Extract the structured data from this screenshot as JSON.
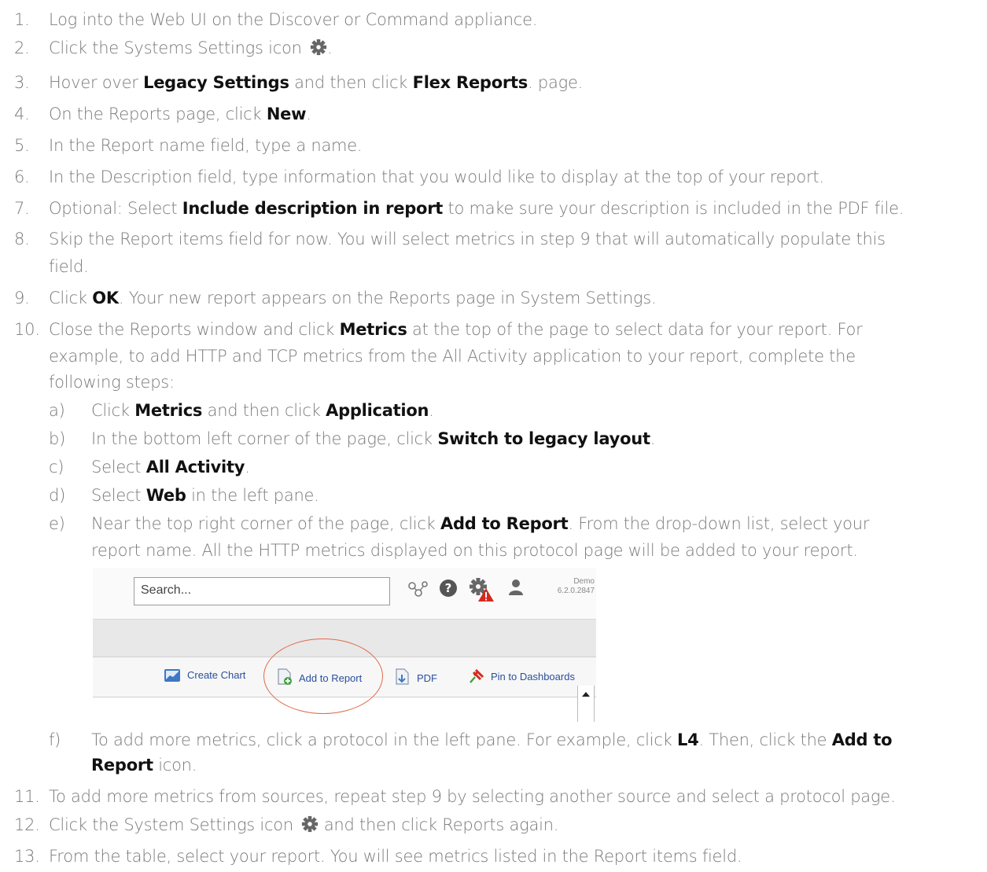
{
  "steps": [
    {
      "num": "1.",
      "parts": [
        {
          "t": "Log into the Web UI on the Discover or Command appliance."
        }
      ]
    },
    {
      "num": "2.",
      "parts": [
        {
          "t": "Click the Systems Settings icon "
        },
        {
          "icon": "gear"
        },
        {
          "t": "."
        }
      ]
    },
    {
      "num": "3.",
      "parts": [
        {
          "t": "Hover over "
        },
        {
          "b": "Legacy Settings"
        },
        {
          "t": " and then click "
        },
        {
          "b": "Flex Reports"
        },
        {
          "t": ". page."
        }
      ]
    },
    {
      "num": "4.",
      "parts": [
        {
          "t": "On the Reports page, click "
        },
        {
          "b": "New"
        },
        {
          "t": "."
        }
      ]
    },
    {
      "num": "5.",
      "parts": [
        {
          "t": "In the Report name field, type a name."
        }
      ]
    },
    {
      "num": "6.",
      "parts": [
        {
          "t": "In the Description field, type information that you would like to display at the top of your report."
        }
      ]
    },
    {
      "num": "7.",
      "parts": [
        {
          "t": "Optional: Select "
        },
        {
          "b": "Include description in report"
        },
        {
          "t": " to make sure your description is included in the PDF file."
        }
      ]
    },
    {
      "num": "8.",
      "parts": [
        {
          "t": "Skip the Report items field for now. You will select metrics in step 9 that will automatically populate this"
        }
      ]
    },
    {
      "num": "",
      "parts": [
        {
          "t": "field."
        }
      ]
    },
    {
      "num": "9.",
      "parts": [
        {
          "t": "Click "
        },
        {
          "b": "OK"
        },
        {
          "t": ". Your new report appears on the Reports page in System Settings."
        }
      ]
    },
    {
      "num": "10.",
      "parts": [
        {
          "t": "Close the Reports window and click "
        },
        {
          "b": "Metrics"
        },
        {
          "t": " at the top of the page to select data for your report. For"
        }
      ]
    },
    {
      "num": "",
      "parts": [
        {
          "t": "example, to add HTTP and TCP metrics from the All Activity application to your report, complete the"
        }
      ]
    },
    {
      "num": "",
      "parts": [
        {
          "t": "following steps:"
        }
      ]
    },
    {
      "num": "a)",
      "sub": true,
      "parts": [
        {
          "t": "Click "
        },
        {
          "b": "Metrics"
        },
        {
          "t": " and then click "
        },
        {
          "b": "Application"
        },
        {
          "t": "."
        }
      ]
    },
    {
      "num": "b)",
      "sub": true,
      "parts": [
        {
          "t": "In the bottom left corner of the page, click "
        },
        {
          "b": "Switch to legacy layout"
        },
        {
          "t": "."
        }
      ]
    },
    {
      "num": "c)",
      "sub": true,
      "parts": [
        {
          "t": "Select "
        },
        {
          "b": "All Activity"
        },
        {
          "t": "."
        }
      ]
    },
    {
      "num": "d)",
      "sub": true,
      "parts": [
        {
          "t": "Select "
        },
        {
          "b": "Web"
        },
        {
          "t": " in the left pane."
        }
      ]
    },
    {
      "num": "e)",
      "sub": true,
      "parts": [
        {
          "t": "Near the top right corner of the page, click "
        },
        {
          "b": "Add to Report"
        },
        {
          "t": ". From the drop-down list, select your"
        }
      ]
    },
    {
      "num": "",
      "sub": true,
      "parts": [
        {
          "t": "report name. All the HTTP metrics displayed on this protocol page will be added to your report."
        }
      ]
    },
    {
      "num": "f)",
      "sub": true,
      "parts": [
        {
          "t": "To add more metrics, click a protocol in the left pane. For example, click "
        },
        {
          "b": "L4"
        },
        {
          "t": ". Then, click the "
        },
        {
          "b": "Add to"
        }
      ]
    },
    {
      "num": "",
      "sub": true,
      "parts": [
        {
          "b": "Report"
        },
        {
          "t": " icon."
        }
      ]
    },
    {
      "num": "11.",
      "parts": [
        {
          "t": "To add more metrics from sources, repeat step 9 by selecting another source and select a protocol page."
        }
      ]
    },
    {
      "num": "12.",
      "parts": [
        {
          "t": "Click the System Settings icon "
        },
        {
          "icon": "gear"
        },
        {
          "t": " and then click Reports again."
        }
      ]
    },
    {
      "num": "13.",
      "parts": [
        {
          "t": "From the table, select your report. You will see metrics listed in the Report items field."
        }
      ]
    }
  ],
  "screenshot": {
    "search_placeholder": "Search...",
    "version_label": "Demo",
    "version_number": "6.2.0.2847",
    "toolbar": {
      "create_chart": "Create Chart",
      "add_to_report": "Add to Report",
      "pdf": "PDF",
      "pin_to_dashboards": "Pin to Dashboards"
    }
  },
  "colors": {
    "text": "#7a7a7a",
    "bold": "#111111",
    "highlight": "#e06a4a",
    "link": "#2a4f9c"
  }
}
